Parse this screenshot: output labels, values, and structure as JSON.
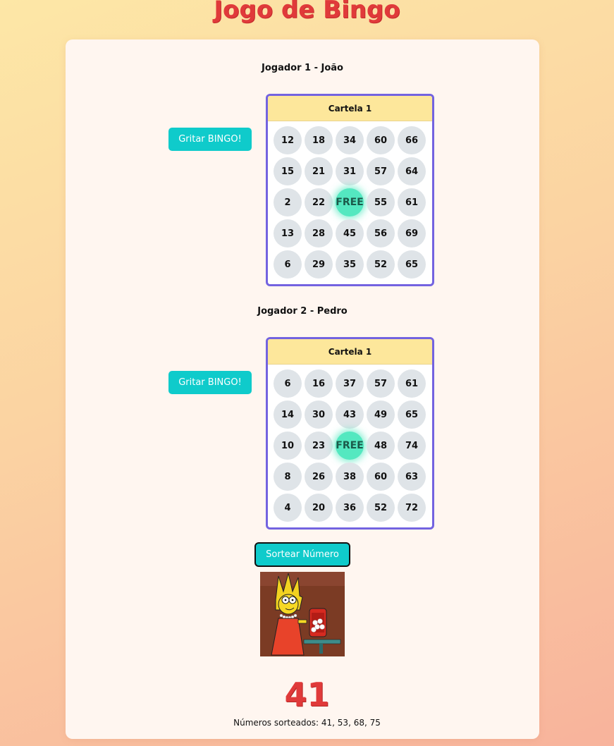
{
  "header": {
    "title": "Jogo de Bingo"
  },
  "players": [
    {
      "name": "Jogador 1 - João",
      "bingo_label": "Gritar BINGO!",
      "card_title": "Cartela 1",
      "cells": [
        "12",
        "18",
        "34",
        "60",
        "66",
        "15",
        "21",
        "31",
        "57",
        "64",
        "2",
        "22",
        "FREE",
        "55",
        "61",
        "13",
        "28",
        "45",
        "56",
        "69",
        "6",
        "29",
        "35",
        "52",
        "65"
      ]
    },
    {
      "name": "Jogador 2 - Pedro",
      "bingo_label": "Gritar BINGO!",
      "card_title": "Cartela 1",
      "cells": [
        "6",
        "16",
        "37",
        "57",
        "61",
        "14",
        "30",
        "43",
        "49",
        "65",
        "10",
        "23",
        "FREE",
        "48",
        "74",
        "8",
        "26",
        "38",
        "60",
        "63",
        "4",
        "20",
        "36",
        "52",
        "72"
      ]
    }
  ],
  "controls": {
    "draw_label": "Sortear Número"
  },
  "current_number": "41",
  "drawn_numbers_text": "Números sorteados: 41, 53, 68, 75",
  "colors": {
    "accent": "#0fcbcb",
    "card_border": "#7363e0",
    "free_cell": "#54e8c0",
    "title_red": "#e03a3a"
  }
}
